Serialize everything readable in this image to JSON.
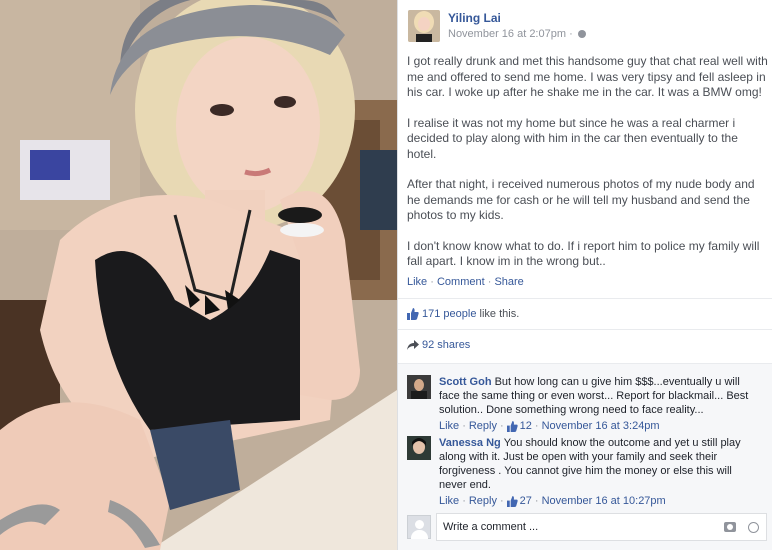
{
  "post": {
    "author": "Yiling Lai",
    "time": "November 16 at 2:07pm · ",
    "paragraphs": [
      "I got really drunk and met this handsome guy that chat real well with me and offered to send me home. I was very tipsy and fell asleep in his car. I woke up after he shake me in the car. It was a BMW omg!",
      "I realise it was not my home but since he was a real charmer i decided to play along with him in the car then eventually to the hotel.",
      "After that night, i received numerous photos of my nude body and he demands me for cash or he will tell my husband and send the photos to my kids.",
      "I don't know know what to do. If i report him to police my family will fall apart. I know im in the wrong but.."
    ],
    "actions": {
      "like": "Like",
      "comment": "Comment",
      "share": "Share",
      "sep": " · "
    }
  },
  "stats": {
    "likes_link": "171 people",
    "likes_suffix": "like this.",
    "shares": "92 shares"
  },
  "comments": [
    {
      "name": "Scott Goh",
      "text": "But how long can u give him $$$...eventually u will face the same thing or even worst... Report for blackmail... Best solution.. Done something wrong need to face reality...",
      "like": "Like",
      "reply": "Reply",
      "count": "12",
      "time": "November 16 at 3:24pm"
    },
    {
      "name": "Vanessa Ng",
      "text": "You should know the outcome and yet u still play along with it. Just be open with your family and seek their forgiveness . You cannot give him the money or else this will never end.",
      "like": "Like",
      "reply": "Reply",
      "count": "27",
      "time": "November 16 at 10:27pm"
    }
  ],
  "composer": {
    "placeholder": "Write a comment ..."
  },
  "icons": {
    "camera": "camera-icon",
    "emoji": "emoji-icon",
    "thumb": "thumbs-up-icon",
    "share": "share-arrow-icon",
    "globe": "globe-icon"
  },
  "colors": {
    "link": "#365899",
    "text": "#4b4f56",
    "muted": "#90949c",
    "comment_bg": "#f6f7f9"
  }
}
